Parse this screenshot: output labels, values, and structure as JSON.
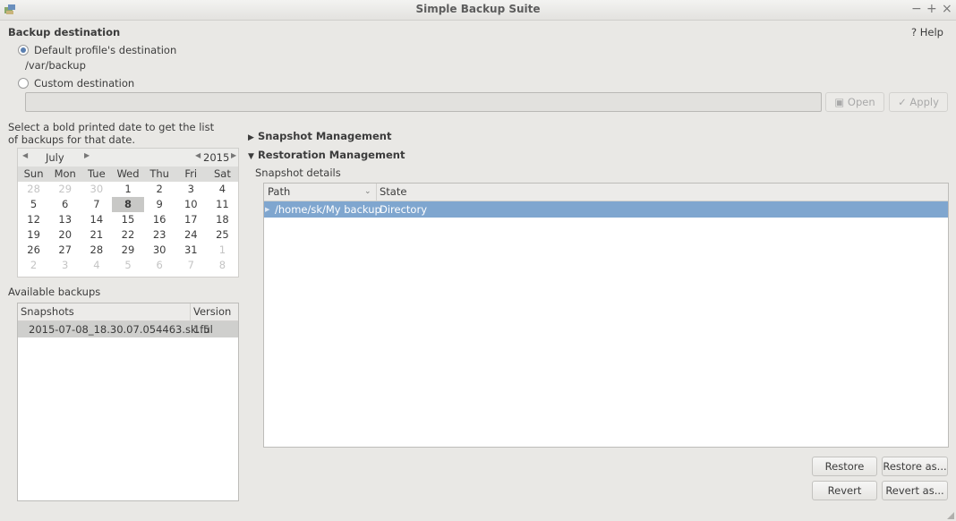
{
  "window": {
    "title": "Simple Backup Suite",
    "minimize_glyph": "−",
    "maximize_glyph": "+",
    "close_glyph": "×"
  },
  "help": {
    "label": "? Help"
  },
  "destination": {
    "heading": "Backup destination",
    "default_option": "Default profile's destination",
    "default_path": "/var/backup",
    "custom_option": "Custom destination",
    "custom_value": "",
    "selected": "default",
    "open_label": "Open",
    "apply_label": "Apply"
  },
  "calendar": {
    "instructions_line1": "Select a bold printed date to get the list",
    "instructions_line2": "of backups for that date.",
    "month": "July",
    "year": "2015",
    "weekdays": [
      "Sun",
      "Mon",
      "Tue",
      "Wed",
      "Thu",
      "Fri",
      "Sat"
    ],
    "weeks": [
      [
        {
          "d": "28",
          "dim": true
        },
        {
          "d": "29",
          "dim": true
        },
        {
          "d": "30",
          "dim": true
        },
        {
          "d": "1"
        },
        {
          "d": "2"
        },
        {
          "d": "3"
        },
        {
          "d": "4"
        }
      ],
      [
        {
          "d": "5"
        },
        {
          "d": "6"
        },
        {
          "d": "7"
        },
        {
          "d": "8",
          "selected": true
        },
        {
          "d": "9"
        },
        {
          "d": "10"
        },
        {
          "d": "11"
        }
      ],
      [
        {
          "d": "12"
        },
        {
          "d": "13"
        },
        {
          "d": "14"
        },
        {
          "d": "15"
        },
        {
          "d": "16"
        },
        {
          "d": "17"
        },
        {
          "d": "18"
        }
      ],
      [
        {
          "d": "19"
        },
        {
          "d": "20"
        },
        {
          "d": "21"
        },
        {
          "d": "22"
        },
        {
          "d": "23"
        },
        {
          "d": "24"
        },
        {
          "d": "25"
        }
      ],
      [
        {
          "d": "26"
        },
        {
          "d": "27"
        },
        {
          "d": "28"
        },
        {
          "d": "29"
        },
        {
          "d": "30"
        },
        {
          "d": "31"
        },
        {
          "d": "1",
          "dim": true
        }
      ],
      [
        {
          "d": "2",
          "dim": true
        },
        {
          "d": "3",
          "dim": true
        },
        {
          "d": "4",
          "dim": true
        },
        {
          "d": "5",
          "dim": true
        },
        {
          "d": "6",
          "dim": true
        },
        {
          "d": "7",
          "dim": true
        },
        {
          "d": "8",
          "dim": true
        }
      ]
    ]
  },
  "backups": {
    "heading": "Available backups",
    "columns": [
      "Snapshots",
      "Version"
    ],
    "rows": [
      {
        "snapshot": "2015-07-08_18.30.07.054463.sk.ful",
        "version": "1.5"
      }
    ]
  },
  "snapshot_management": {
    "label": "Snapshot Management",
    "expanded": false
  },
  "restoration_management": {
    "label": "Restoration Management",
    "expanded": true,
    "details_label": "Snapshot details",
    "columns": [
      "Path",
      "State"
    ],
    "rows": [
      {
        "path": "/home/sk/My backup",
        "state": "Directory"
      }
    ],
    "restore_label": "Restore",
    "restore_as_label": "Restore as...",
    "revert_label": "Revert",
    "revert_as_label": "Revert as..."
  }
}
